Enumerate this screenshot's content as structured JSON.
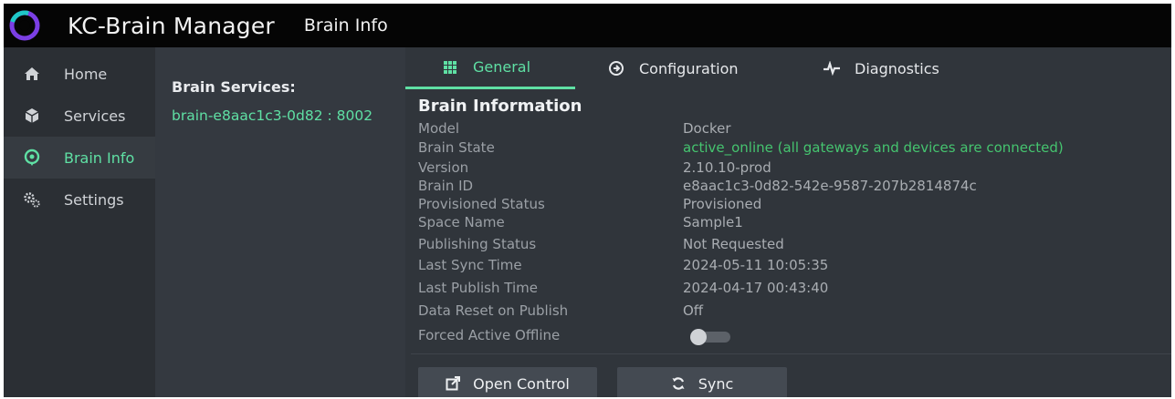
{
  "app": {
    "title": "KC-Brain Manager",
    "page_title": "Brain Info",
    "accent_color": "#5fe0a4",
    "status_color": "#45c46f"
  },
  "sidebar": {
    "items": [
      {
        "label": "Home",
        "icon": "home-icon"
      },
      {
        "label": "Services",
        "icon": "cube-icon"
      },
      {
        "label": "Brain Info",
        "icon": "brain-icon",
        "active": true
      },
      {
        "label": "Settings",
        "icon": "gears-icon"
      }
    ]
  },
  "services": {
    "title": "Brain Services:",
    "items": [
      "brain-e8aac1c3-0d82 : 8002"
    ]
  },
  "tabs": [
    {
      "label": "General",
      "icon": "grid-icon",
      "active": true
    },
    {
      "label": "Configuration",
      "icon": "arrow-circle-icon"
    },
    {
      "label": "Diagnostics",
      "icon": "pulse-icon"
    }
  ],
  "info": {
    "title": "Brain Information",
    "rows": [
      {
        "label": "Model",
        "value": "Docker"
      },
      {
        "label": "Brain State",
        "value": "active_online (all gateways and devices  are connected)"
      },
      {
        "label": "Version",
        "value": "2.10.10-prod"
      },
      {
        "label": "Brain ID",
        "value": "e8aac1c3-0d82-542e-9587-207b2814874c"
      },
      {
        "label": "Provisioned Status",
        "value": "Provisioned"
      },
      {
        "label": "Space Name",
        "value": "Sample1"
      },
      {
        "label": "Publishing Status",
        "value": "Not Requested"
      },
      {
        "label": "Last Sync Time",
        "value": "2024-05-11  10:05:35"
      },
      {
        "label": "Last Publish Time",
        "value": "2024-04-17  00:43:40"
      },
      {
        "label": "Data Reset on Publish",
        "value": "Off"
      },
      {
        "label": "Forced Active Offline",
        "toggle": false
      }
    ]
  },
  "actions": {
    "open_control": "Open Control",
    "sync": "Sync"
  }
}
